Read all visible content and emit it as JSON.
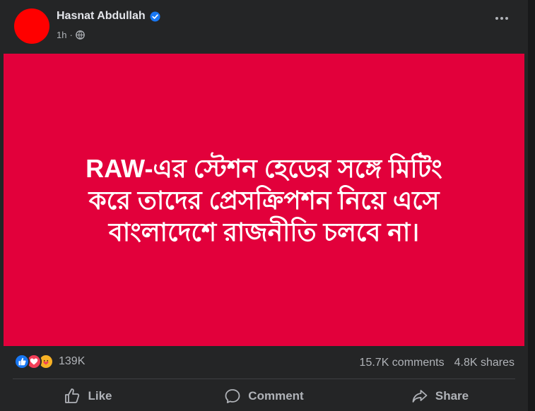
{
  "post": {
    "author": "Hasnat Abdullah",
    "time": "1h",
    "separator": "·",
    "text_lines": [
      "RAW-এর স্টেশন হেডের সঙ্গে মিটিং",
      "করে তাদের প্রেসক্রিপশন নিয়ে এসে",
      "বাংলাদেশে রাজনীতি চলবে না।"
    ],
    "image_bg": "#e2003b"
  },
  "stats": {
    "reaction_count": "139K",
    "comments": "15.7K comments",
    "shares": "4.8K shares"
  },
  "actions": {
    "like": "Like",
    "comment": "Comment",
    "share": "Share"
  },
  "colors": {
    "card": "#242526",
    "accent": "#1877f2",
    "avatar": "#ff0000"
  }
}
